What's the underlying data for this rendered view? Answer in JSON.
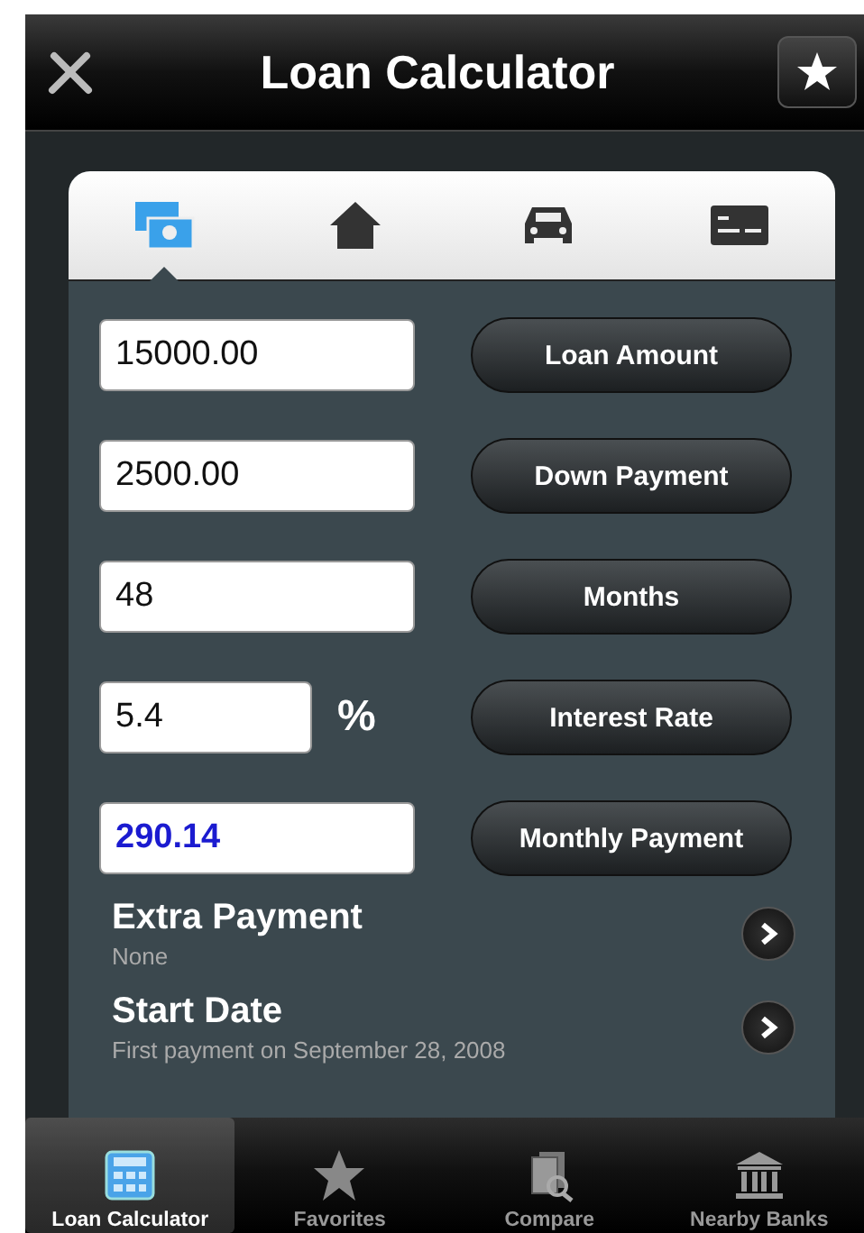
{
  "nav_bar": {
    "title": "Loan Calculator"
  },
  "loan_types": [
    {
      "kind": "money",
      "selected": true
    },
    {
      "kind": "house",
      "selected": false
    },
    {
      "kind": "car",
      "selected": false
    },
    {
      "kind": "card",
      "selected": false
    }
  ],
  "fields": [
    {
      "value": "15000.00",
      "button": "Loan Amount",
      "result": false
    },
    {
      "value": "2500.00",
      "button": "Down Payment",
      "result": false
    },
    {
      "value": "48",
      "button": "Months",
      "result": false
    },
    {
      "value": "5.4",
      "suffix": "%",
      "button": "Interest Rate",
      "result": false
    },
    {
      "value": "290.14",
      "button": "Monthly Payment",
      "result": true
    }
  ],
  "options": [
    {
      "title": "Extra Payment",
      "subtitle": "None"
    },
    {
      "title": "Start Date",
      "subtitle": "First payment on September 28, 2008"
    }
  ],
  "tab_bar": [
    {
      "label": "Loan Calculator",
      "kind": "calculator",
      "selected": true
    },
    {
      "label": "Favorites",
      "kind": "star",
      "selected": false
    },
    {
      "label": "Compare",
      "kind": "documents",
      "selected": false
    },
    {
      "label": "Nearby Banks",
      "kind": "bank",
      "selected": false
    }
  ]
}
